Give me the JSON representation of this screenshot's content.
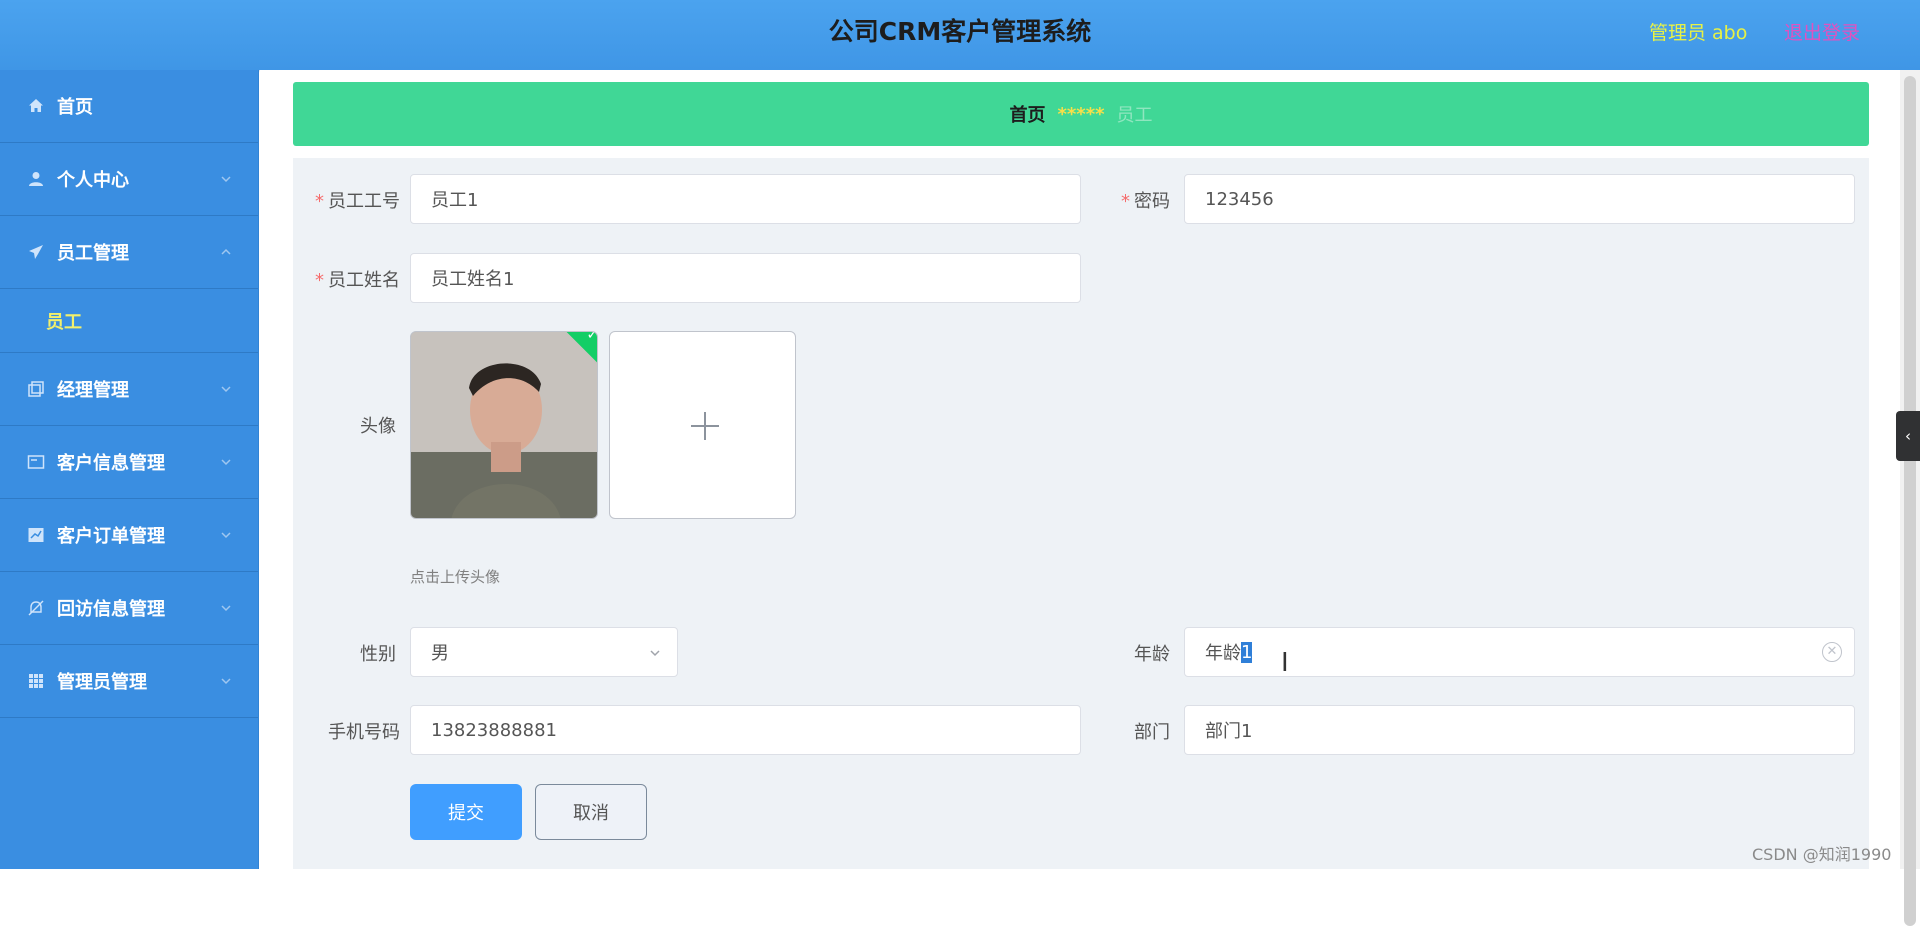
{
  "header": {
    "title": "公司CRM客户管理系统",
    "user": "管理员 abo",
    "logout": "退出登录"
  },
  "sidebar": {
    "items": [
      {
        "label": "首页",
        "icon": "home-icon"
      },
      {
        "label": "个人中心",
        "icon": "user-icon"
      },
      {
        "label": "员工管理",
        "icon": "paper-plane-icon",
        "expanded": true,
        "sub": "员工"
      },
      {
        "label": "经理管理",
        "icon": "copy-icon"
      },
      {
        "label": "客户信息管理",
        "icon": "card-icon"
      },
      {
        "label": "客户订单管理",
        "icon": "chart-icon"
      },
      {
        "label": "回访信息管理",
        "icon": "bell-off-icon"
      },
      {
        "label": "管理员管理",
        "icon": "grid-icon"
      }
    ]
  },
  "breadcrumb": {
    "home": "首页",
    "sep": "*****",
    "current": "员工"
  },
  "form": {
    "emp_no": {
      "label": "员工工号",
      "value": "员工1"
    },
    "password": {
      "label": "密码",
      "value": "123456"
    },
    "emp_name": {
      "label": "员工姓名",
      "value": "员工姓名1"
    },
    "avatar": {
      "label": "头像",
      "hint": "点击上传头像"
    },
    "gender": {
      "label": "性别",
      "value": "男"
    },
    "age": {
      "label": "年龄",
      "value_prefix": "年龄",
      "value_selected": "1"
    },
    "phone": {
      "label": "手机号码",
      "value": "13823888881"
    },
    "dept": {
      "label": "部门",
      "value": "部门1"
    },
    "submit": "提交",
    "cancel": "取消"
  },
  "watermark": "CSDN @知润1990",
  "colors": {
    "header": "#4ba3ef",
    "sidebar": "#3a8ee1",
    "crumb": "#40d796",
    "primary": "#409eff",
    "required": "#f56c6c"
  }
}
